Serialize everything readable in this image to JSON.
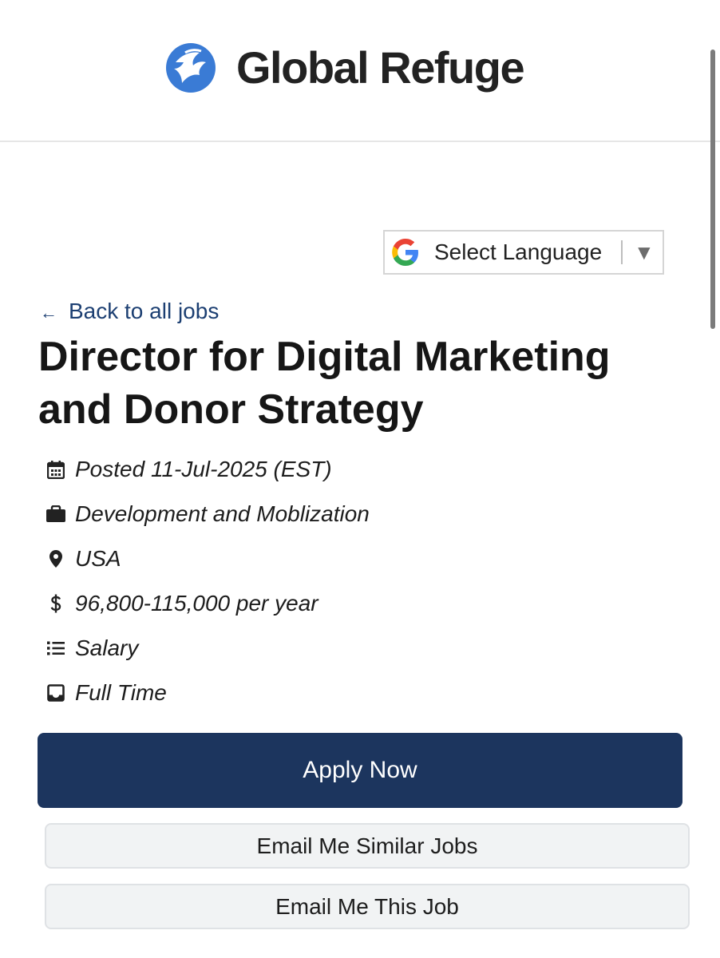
{
  "header": {
    "logo_text": "Global Refuge",
    "logo_icon": "globe-flame-logo-icon"
  },
  "translate": {
    "label": "Select Language",
    "icon": "google-g-icon",
    "arrow": "▼"
  },
  "nav": {
    "back_label": "Back to all jobs",
    "back_arrow": "←"
  },
  "job": {
    "title": "Director for Digital Marketing and Donor Strategy",
    "meta": [
      {
        "icon": "calendar-icon",
        "text": "Posted 11-Jul-2025 (EST)"
      },
      {
        "icon": "briefcase-icon",
        "text": "Development and Moblization"
      },
      {
        "icon": "location-pin-icon",
        "text": "USA"
      },
      {
        "icon": "dollar-icon",
        "text": "96,800-115,000 per year"
      },
      {
        "icon": "list-icon",
        "text": "Salary"
      },
      {
        "icon": "inbox-icon",
        "text": "Full Time"
      }
    ]
  },
  "actions": {
    "apply_label": "Apply Now",
    "email_similar_label": "Email Me Similar Jobs",
    "email_this_label": "Email Me This Job"
  },
  "colors": {
    "primary": "#1c355e",
    "link": "#1c3f72",
    "logo_blue": "#3a7bd5",
    "secondary_button_bg": "#f1f3f4"
  }
}
